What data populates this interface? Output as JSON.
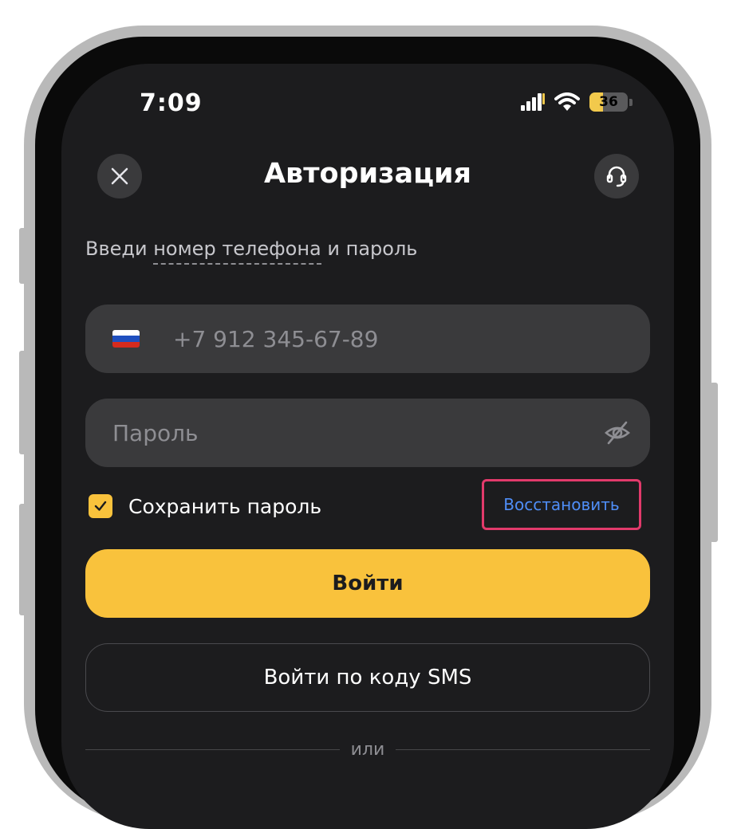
{
  "status_bar": {
    "time": "7:09",
    "battery": "36"
  },
  "header": {
    "title": "Авторизация",
    "close_icon": "close-icon",
    "support_icon": "headset-icon"
  },
  "instructions": {
    "before": "Введи ",
    "link": "номер телефона",
    "after": " и пароль"
  },
  "phone_field": {
    "flag": "russia-flag",
    "placeholder": "+7 912 345-67-89"
  },
  "password_field": {
    "placeholder": "Пароль",
    "toggle_icon": "eye-slash-icon"
  },
  "remember": {
    "label": "Сохранить пароль",
    "checked": true
  },
  "restore_label": "Восстановить",
  "login_label": "Войти",
  "sms_login_label": "Войти по коду SMS",
  "divider_label": "или",
  "colors": {
    "accent": "#f9c23c",
    "background": "#1c1c1e",
    "field": "#3a3a3c",
    "link": "#4f8ef7",
    "highlight": "#e23a6b"
  }
}
